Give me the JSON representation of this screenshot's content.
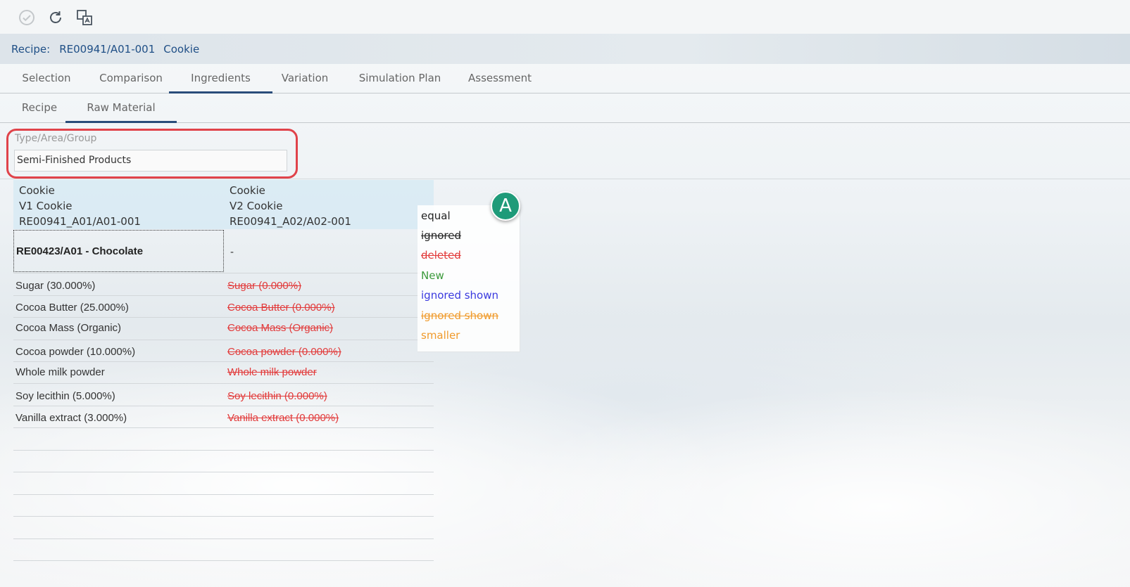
{
  "toolbar": {
    "icons": [
      "check-circle-icon",
      "refresh-icon",
      "translate-icon"
    ]
  },
  "recipe": {
    "label": "Recipe:",
    "id": "RE00941/A01-001",
    "name": "Cookie"
  },
  "tabs": [
    "Selection",
    "Comparison",
    "Ingredients",
    "Variation",
    "Simulation Plan",
    "Assessment"
  ],
  "active_tab": "Ingredients",
  "subtabs": [
    "Recipe",
    "Raw Material"
  ],
  "active_subtab": "Raw Material",
  "filter": {
    "label": "Type/Area/Group",
    "value": "Semi-Finished Products"
  },
  "columns": [
    {
      "line1": "Cookie",
      "line2": "V1 Cookie",
      "line3": "RE00941_A01/A01-001"
    },
    {
      "line1": "Cookie",
      "line2": "V2 Cookie",
      "line3": "RE00941_A02/A02-001"
    }
  ],
  "group_row": {
    "left": "RE00423/A01 - Chocolate",
    "right": "-"
  },
  "rows": [
    {
      "left": "Sugar (30.000%)",
      "right": "Sugar (0.000%)"
    },
    {
      "left": "Cocoa Butter (25.000%)",
      "right": "Cocoa Butter (0.000%)"
    },
    {
      "left": "Cocoa Mass (Organic)",
      "right": "Cocoa Mass (Organic)"
    },
    {
      "left": "Cocoa powder (10.000%)",
      "right": "Cocoa powder (0.000%)"
    },
    {
      "left": "Whole milk powder",
      "right": "Whole milk powder"
    },
    {
      "left": "Soy lecithin (5.000%)",
      "right": "Soy lecithin (0.000%)"
    },
    {
      "left": "Vanilla extract (3.000%)",
      "right": "Vanilla extract (0.000%)"
    }
  ],
  "legend": [
    {
      "label": "equal",
      "color": "#222222",
      "strike": false
    },
    {
      "label": "ignored",
      "color": "#222222",
      "strike": true
    },
    {
      "label": "deleted",
      "color": "#e23a3a",
      "strike": true
    },
    {
      "label": "New",
      "color": "#3b9a3b",
      "strike": false
    },
    {
      "label": "ignored shown",
      "color": "#3a3adf",
      "strike": false
    },
    {
      "label": "ignored shown",
      "color": "#f09a2a",
      "strike": true
    },
    {
      "label": "smaller",
      "color": "#f09a2a",
      "strike": false
    }
  ],
  "badge": "A",
  "colors": {
    "accent": "#2a4d7a",
    "highlight_border": "#e0434a",
    "deleted": "#e23a3a",
    "badge": "#1f9b79"
  }
}
